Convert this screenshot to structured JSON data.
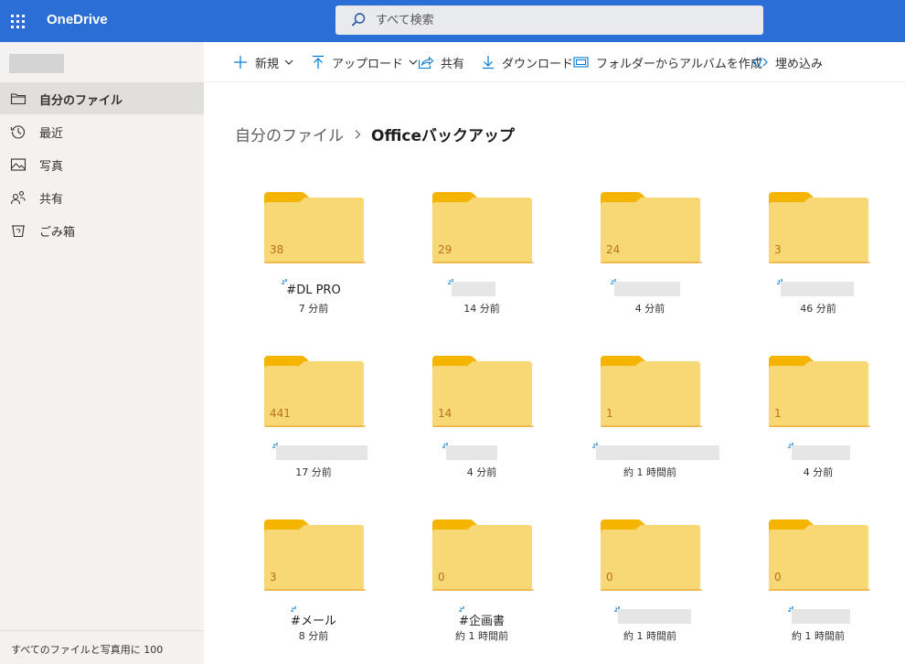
{
  "app": {
    "title": "OneDrive"
  },
  "search": {
    "placeholder": "すべて検索"
  },
  "sidebar": {
    "items": [
      {
        "label": "自分のファイル",
        "icon": "folder-icon",
        "active": true
      },
      {
        "label": "最近",
        "icon": "recent-clock-icon"
      },
      {
        "label": "写真",
        "icon": "photo-icon"
      },
      {
        "label": "共有",
        "icon": "shared-people-icon"
      },
      {
        "label": "ごみ箱",
        "icon": "recycle-bin-icon"
      }
    ],
    "footer": "すべてのファイルと写真用に 100"
  },
  "toolbar": {
    "new_label": "新規",
    "upload_label": "アップロード",
    "share_label": "共有",
    "download_label": "ダウンロード",
    "album_label": "フォルダーからアルバムを作成",
    "embed_label": "埋め込み"
  },
  "breadcrumb": {
    "root": "自分のファイル",
    "current": "Officeバックアップ"
  },
  "folders": [
    {
      "count": "38",
      "name": "#DL PRO",
      "modified": "7 分前"
    },
    {
      "count": "29",
      "name": "",
      "modified": "14 分前"
    },
    {
      "count": "24",
      "name": "",
      "modified": "4 分前"
    },
    {
      "count": "3",
      "name": "",
      "modified": "46 分前"
    },
    {
      "count": "441",
      "name": "",
      "modified": "17 分前"
    },
    {
      "count": "14",
      "name": "",
      "modified": "4 分前"
    },
    {
      "count": "1",
      "name": "",
      "modified": "約 1 時間前"
    },
    {
      "count": "1",
      "name": "",
      "modified": "4 分前"
    },
    {
      "count": "3",
      "name": "#メール",
      "modified": "8 分前"
    },
    {
      "count": "0",
      "name": "#企画書",
      "modified": "約 1 時間前"
    },
    {
      "count": "0",
      "name": "",
      "modified": "約 1 時間前"
    },
    {
      "count": "0",
      "name": "",
      "modified": "約 1 時間前"
    }
  ],
  "colors": {
    "topbar": "#2b6fd6",
    "folder_back": "#f4b400",
    "folder_front": "#f8d775",
    "accent": "#0078d4"
  }
}
